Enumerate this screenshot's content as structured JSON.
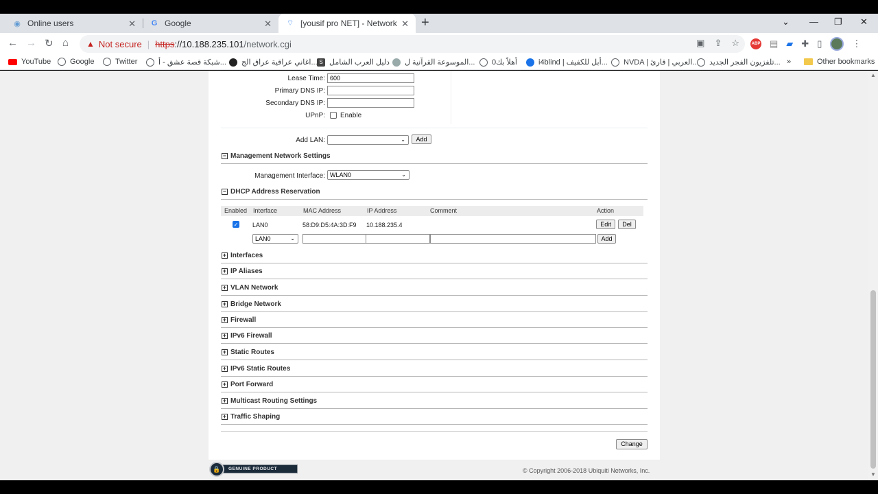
{
  "browser": {
    "tabs": [
      {
        "label": "Online users",
        "icon": "globe-icon"
      },
      {
        "label": "Google",
        "icon": "google-icon"
      },
      {
        "label": "[yousif pro NET] - Network",
        "icon": "wifi-icon"
      }
    ],
    "security_label": "Not secure",
    "url_scheme": "https",
    "url_host": "://10.188.235.101",
    "url_path": "/network.cgi",
    "bookmarks": [
      "YouTube",
      "Google",
      "Twitter",
      "شبكة قصة عشق - أ...",
      "اغاني عراقية عراق الج...",
      "دليل العرب الشامل",
      "الموسوعة القرآنية ل...",
      "0أهلاً بك",
      "i4blind | أبل للكفيف...",
      "NVDA | العربي | قارئ...",
      "تلفزيون الفجر الجديد..."
    ],
    "bookmarks_more": "»",
    "other_bookmarks": "Other bookmarks"
  },
  "lan": {
    "lease_time_label": "Lease Time:",
    "lease_time_value": "600",
    "primary_dns_label": "Primary DNS IP:",
    "primary_dns_value": "",
    "secondary_dns_label": "Secondary DNS IP:",
    "secondary_dns_value": "",
    "upnp_label": "UPnP:",
    "upnp_enable_label": "Enable",
    "add_lan_label": "Add LAN:",
    "add_lan_value": "",
    "add_button": "Add"
  },
  "management": {
    "title": "Management Network Settings",
    "interface_label": "Management Interface:",
    "interface_value": "WLAN0"
  },
  "dhcp": {
    "title": "DHCP Address Reservation",
    "headers": [
      "Enabled",
      "Interface",
      "MAC Address",
      "IP Address",
      "Comment",
      "Action"
    ],
    "row": {
      "interface": "LAN0",
      "mac": "58:D9:D5:4A:3D:F9",
      "ip": "10.188.235.4",
      "comment": "",
      "edit": "Edit",
      "del": "Del"
    },
    "new_interface": "LAN0",
    "add_button": "Add"
  },
  "sections": [
    "Interfaces",
    "IP Aliases",
    "VLAN Network",
    "Bridge Network",
    "Firewall",
    "IPv6 Firewall",
    "Static Routes",
    "IPv6 Static Routes",
    "Port Forward",
    "Multicast Routing Settings",
    "Traffic Shaping"
  ],
  "change_button": "Change",
  "footer": {
    "genuine": "GENUINE PRODUCT",
    "copyright": "© Copyright 2006-2018 Ubiquiti Networks, Inc."
  }
}
